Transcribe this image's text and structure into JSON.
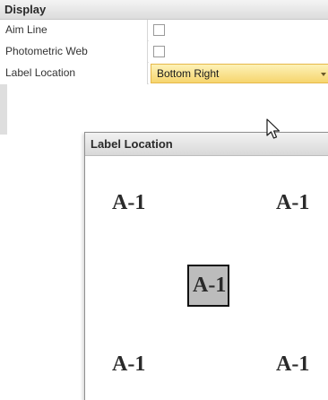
{
  "properties": {
    "section_title": "Display",
    "rows": [
      {
        "label": "Aim Line",
        "type": "checkbox",
        "checked": false
      },
      {
        "label": "Photometric Web",
        "type": "checkbox",
        "checked": false
      },
      {
        "label": "Label Location",
        "type": "dropdown",
        "value": "Bottom Right"
      }
    ]
  },
  "popup": {
    "title": "Label Location",
    "cells": [
      {
        "position": "top-left",
        "text": "A-1",
        "selected": false
      },
      {
        "position": "top-right",
        "text": "A-1",
        "selected": false
      },
      {
        "position": "center",
        "text": "A-1",
        "selected": true
      },
      {
        "position": "bottom-left",
        "text": "A-1",
        "selected": false
      },
      {
        "position": "bottom-right",
        "text": "A-1",
        "selected": false
      }
    ]
  },
  "colors": {
    "dropdown_highlight": "#f6d56e",
    "selected_cell_bg": "#bcbcbc"
  }
}
